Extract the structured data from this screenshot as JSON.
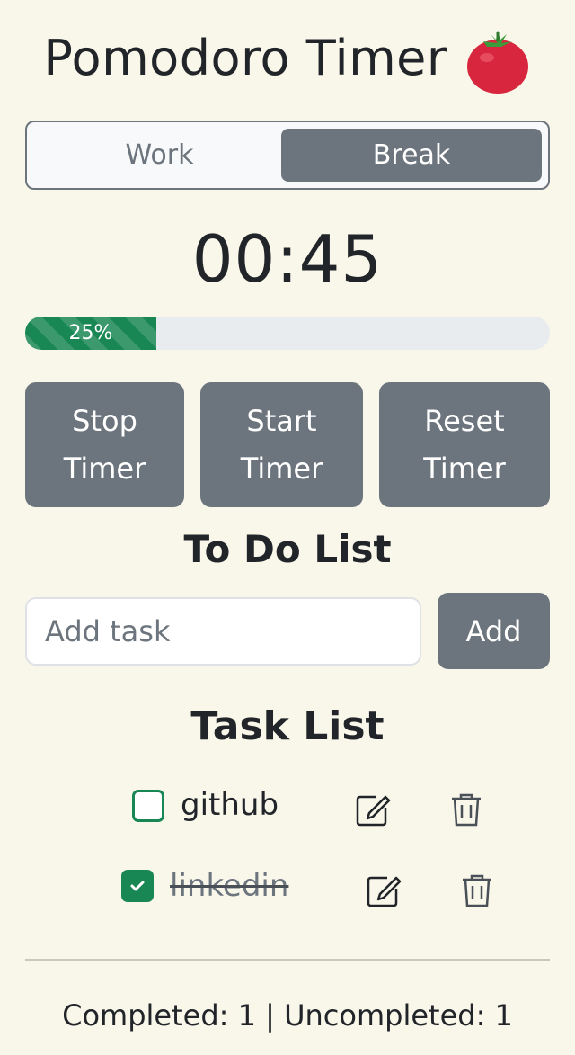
{
  "header": {
    "title": "Pomodoro Timer",
    "icon": "tomato-icon"
  },
  "mode_toggle": {
    "options": [
      "Work",
      "Break"
    ],
    "active": "Break"
  },
  "timer": {
    "display": "00:45"
  },
  "progress": {
    "value": 0.25,
    "label": "25%"
  },
  "controls": {
    "stop_line1": "Stop",
    "stop_line2": "Timer",
    "start_line1": "Start",
    "start_line2": "Timer",
    "reset_line1": "Reset",
    "reset_line2": "Timer"
  },
  "todo": {
    "heading": "To Do List",
    "input_placeholder": "Add task",
    "input_value": "",
    "add_label": "Add"
  },
  "task_list": {
    "heading": "Task List",
    "tasks": [
      {
        "label": "github",
        "completed": false
      },
      {
        "label": "linkedin",
        "completed": true
      }
    ]
  },
  "summary": {
    "text": "Completed: 1 | Uncompleted: 1"
  },
  "colors": {
    "background": "#f9f6ea",
    "secondary": "#6c757d",
    "success": "#198754",
    "progress_track": "#e9ecef"
  }
}
